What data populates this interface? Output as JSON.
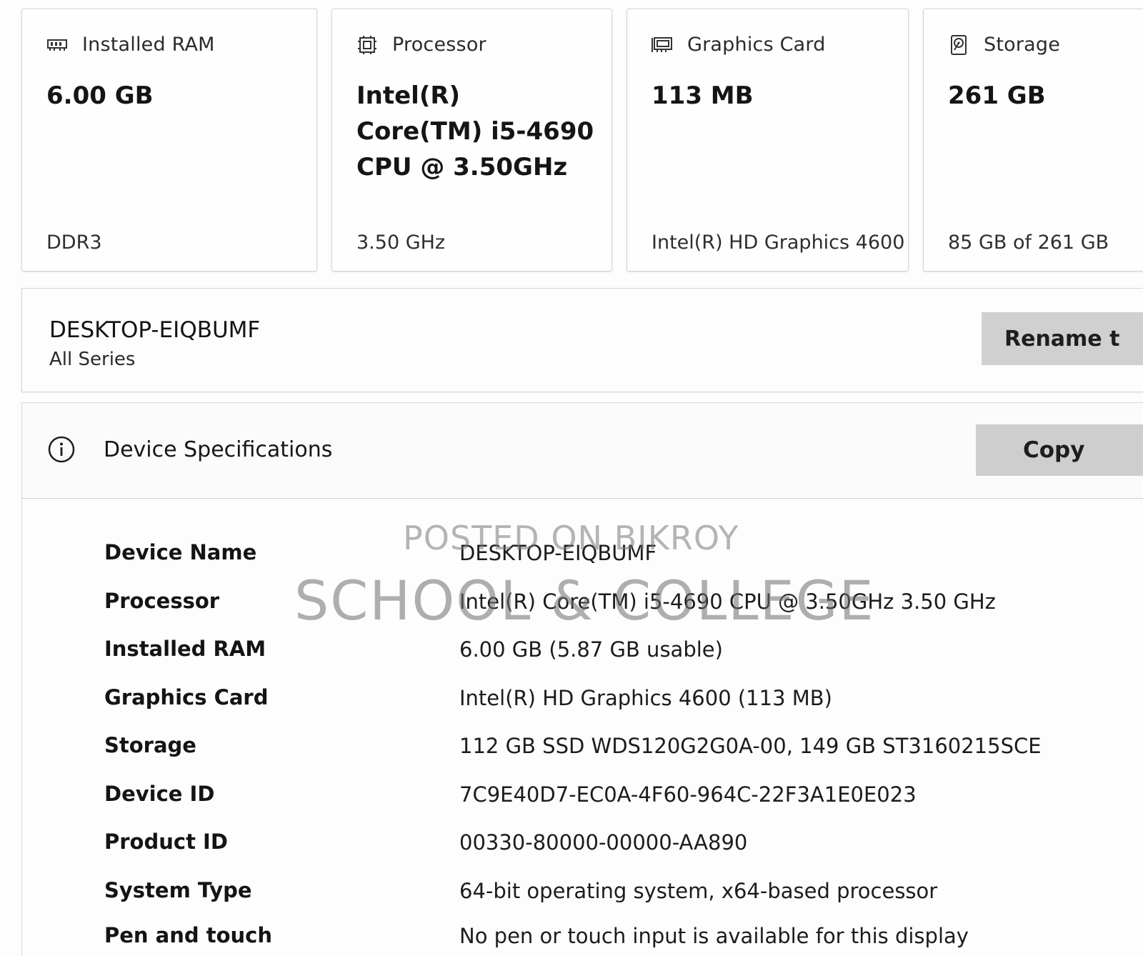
{
  "cards": [
    {
      "title": "Installed RAM",
      "icon": "ram-icon",
      "value": "6.00 GB",
      "sub": "DDR3"
    },
    {
      "title": "Processor",
      "icon": "processor-icon",
      "value": "Intel(R) Core(TM) i5-4690 CPU @ 3.50GHz",
      "sub": "3.50 GHz"
    },
    {
      "title": "Graphics Card",
      "icon": "graphics-card-icon",
      "value": "113 MB",
      "sub": "Intel(R) HD Graphics 4600"
    },
    {
      "title": "Storage",
      "icon": "storage-icon",
      "value": "261 GB",
      "sub": "85 GB of 261 GB"
    }
  ],
  "device": {
    "name": "DESKTOP-EIQBUMF",
    "model": "All Series",
    "rename_label": "Rename t"
  },
  "specs": {
    "title": "Device Specifications",
    "copy_label": "Copy",
    "rows": [
      {
        "key": "Device Name",
        "value": "DESKTOP-EIQBUMF"
      },
      {
        "key": "Processor",
        "value": "Intel(R) Core(TM) i5-4690 CPU @ 3.50GHz   3.50 GHz"
      },
      {
        "key": "Installed RAM",
        "value": "6.00 GB (5.87 GB usable)"
      },
      {
        "key": "Graphics Card",
        "value": "Intel(R) HD Graphics 4600 (113 MB)"
      },
      {
        "key": "Storage",
        "value": "112 GB SSD WDS120G2G0A-00, 149 GB ST3160215SCE"
      },
      {
        "key": "Device ID",
        "value": "7C9E40D7-EC0A-4F60-964C-22F3A1E0E023"
      },
      {
        "key": "Product ID",
        "value": "00330-80000-00000-AA890"
      },
      {
        "key": "System Type",
        "value": "64-bit operating system, x64-based processor"
      },
      {
        "key": "Pen and touch",
        "value": "No pen or touch input is available for this display"
      }
    ]
  },
  "watermark": {
    "line1": "POSTED ON BIKROY",
    "line2": "SCHOOL & COLLEGE"
  },
  "colors": {
    "button_bg": "#d0d0d0",
    "card_border": "#d4d4d4",
    "text": "#1b1b1b"
  }
}
